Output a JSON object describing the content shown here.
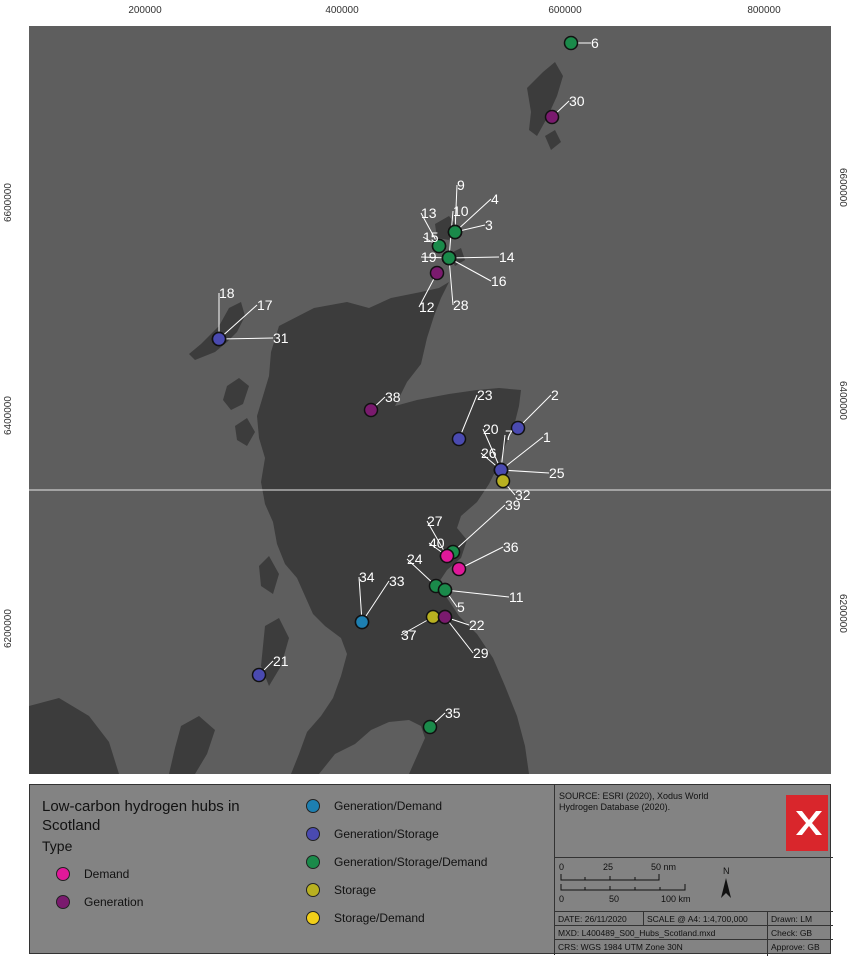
{
  "x_ticks": [
    "200000",
    "400000",
    "600000",
    "800000"
  ],
  "y_ticks": [
    "6600000",
    "6400000",
    "6200000"
  ],
  "colors": {
    "demand": "#e0189a",
    "generation": "#7a1a6e",
    "generation_demand": "#1d7fb1",
    "generation_storage": "#4a4ab0",
    "generation_storage_demand": "#1a8a4a",
    "storage": "#b8b020",
    "storage_demand": "#f2cf18"
  },
  "hubs": [
    {
      "label": "6",
      "type": "generation_storage_demand"
    },
    {
      "label": "30",
      "type": "generation"
    },
    {
      "label": "9",
      "type": "generation_storage_demand"
    },
    {
      "label": "4",
      "type": "generation_storage_demand"
    },
    {
      "label": "13",
      "type": "generation_storage_demand"
    },
    {
      "label": "10",
      "type": "generation_storage_demand"
    },
    {
      "label": "3",
      "type": "generation_storage_demand"
    },
    {
      "label": "15",
      "type": "generation_storage_demand"
    },
    {
      "label": "14",
      "type": "generation_storage_demand"
    },
    {
      "label": "19",
      "type": "generation_storage_demand"
    },
    {
      "label": "16",
      "type": "generation_storage_demand"
    },
    {
      "label": "12",
      "type": "generation"
    },
    {
      "label": "28",
      "type": "generation_storage_demand"
    },
    {
      "label": "18",
      "type": "generation_storage"
    },
    {
      "label": "17",
      "type": "generation_storage"
    },
    {
      "label": "31",
      "type": "generation_storage"
    },
    {
      "label": "38",
      "type": "generation"
    },
    {
      "label": "23",
      "type": "generation_storage"
    },
    {
      "label": "2",
      "type": "generation_storage"
    },
    {
      "label": "20",
      "type": "generation_storage"
    },
    {
      "label": "7",
      "type": "generation_storage"
    },
    {
      "label": "1",
      "type": "generation_storage"
    },
    {
      "label": "26",
      "type": "generation_storage"
    },
    {
      "label": "25",
      "type": "generation_storage"
    },
    {
      "label": "32",
      "type": "storage"
    },
    {
      "label": "39",
      "type": "generation_storage_demand"
    },
    {
      "label": "27",
      "type": "generation_storage_demand"
    },
    {
      "label": "40",
      "type": "demand"
    },
    {
      "label": "36",
      "type": "demand"
    },
    {
      "label": "24",
      "type": "generation_storage_demand"
    },
    {
      "label": "11",
      "type": "generation_storage_demand"
    },
    {
      "label": "5",
      "type": "generation_storage_demand"
    },
    {
      "label": "34",
      "type": "generation_demand"
    },
    {
      "label": "33",
      "type": "generation_demand"
    },
    {
      "label": "37",
      "type": "storage"
    },
    {
      "label": "22",
      "type": "generation"
    },
    {
      "label": "29",
      "type": "generation"
    },
    {
      "label": "21",
      "type": "generation_storage"
    },
    {
      "label": "35",
      "type": "generation_storage_demand"
    }
  ],
  "legend": {
    "title": "Low-carbon hydrogen hubs in Scotland",
    "type_label": "Type",
    "demand": "Demand",
    "generation": "Generation",
    "generation_demand": "Generation/Demand",
    "generation_storage": "Generation/Storage",
    "generation_storage_demand": "Generation/Storage/Demand",
    "storage": "Storage",
    "storage_demand": "Storage/Demand"
  },
  "info": {
    "source": "SOURCE: ESRI (2020), Xodus World Hydrogen Database (2020).",
    "scale_nm": [
      "0",
      "25",
      "50 nm"
    ],
    "scale_km": [
      "0",
      "50",
      "100 km"
    ],
    "north": "N",
    "date": "DATE: 26/11/2020",
    "scale": "SCALE @ A4:  1:4,700,000",
    "drawn": "Drawn: LM",
    "mxd": "MXD: L400489_S00_Hubs_Scotland.mxd",
    "check": "Check: GB",
    "crs": "CRS: WGS 1984 UTM Zone 30N",
    "approve": "Approve: GB"
  }
}
